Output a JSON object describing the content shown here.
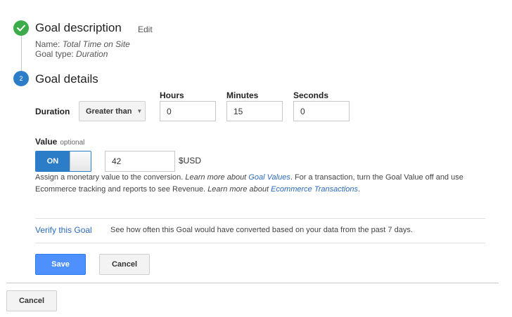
{
  "step1": {
    "title": "Goal description",
    "edit_label": "Edit",
    "name_label": "Name:",
    "name_value": "Total Time on Site",
    "type_label": "Goal type:",
    "type_value": "Duration"
  },
  "step2": {
    "number": "2",
    "title": "Goal details"
  },
  "duration": {
    "label": "Duration",
    "condition": "Greater than",
    "hours_label": "Hours",
    "minutes_label": "Minutes",
    "seconds_label": "Seconds",
    "hours": "0",
    "minutes": "15",
    "seconds": "0"
  },
  "value": {
    "label": "Value",
    "optional": "optional",
    "toggle_state": "ON",
    "amount": "42",
    "currency": "$USD",
    "help_1a": "Assign a monetary value to the conversion. ",
    "help_1b": "Learn more about ",
    "help_1c": "Goal Values",
    "help_1d": ". For a transaction, turn the Goal Value off and use",
    "help_2a": "Ecommerce tracking and reports to see Revenue. ",
    "help_2b": "Learn more about ",
    "help_2c": "Ecommerce Transactions",
    "help_2d": "."
  },
  "verify": {
    "link": "Verify this Goal",
    "description": "See how often this Goal would have converted based on your data from the past 7 days."
  },
  "actions": {
    "save": "Save",
    "cancel": "Cancel",
    "outer_cancel": "Cancel"
  },
  "colors": {
    "complete_step": "#3cab4a",
    "active_step": "#2b7dc8",
    "link": "#2b6ab8",
    "primary_button": "#4d90fe"
  },
  "icons": {
    "step1": "check-icon",
    "select": "caret-down-icon"
  }
}
